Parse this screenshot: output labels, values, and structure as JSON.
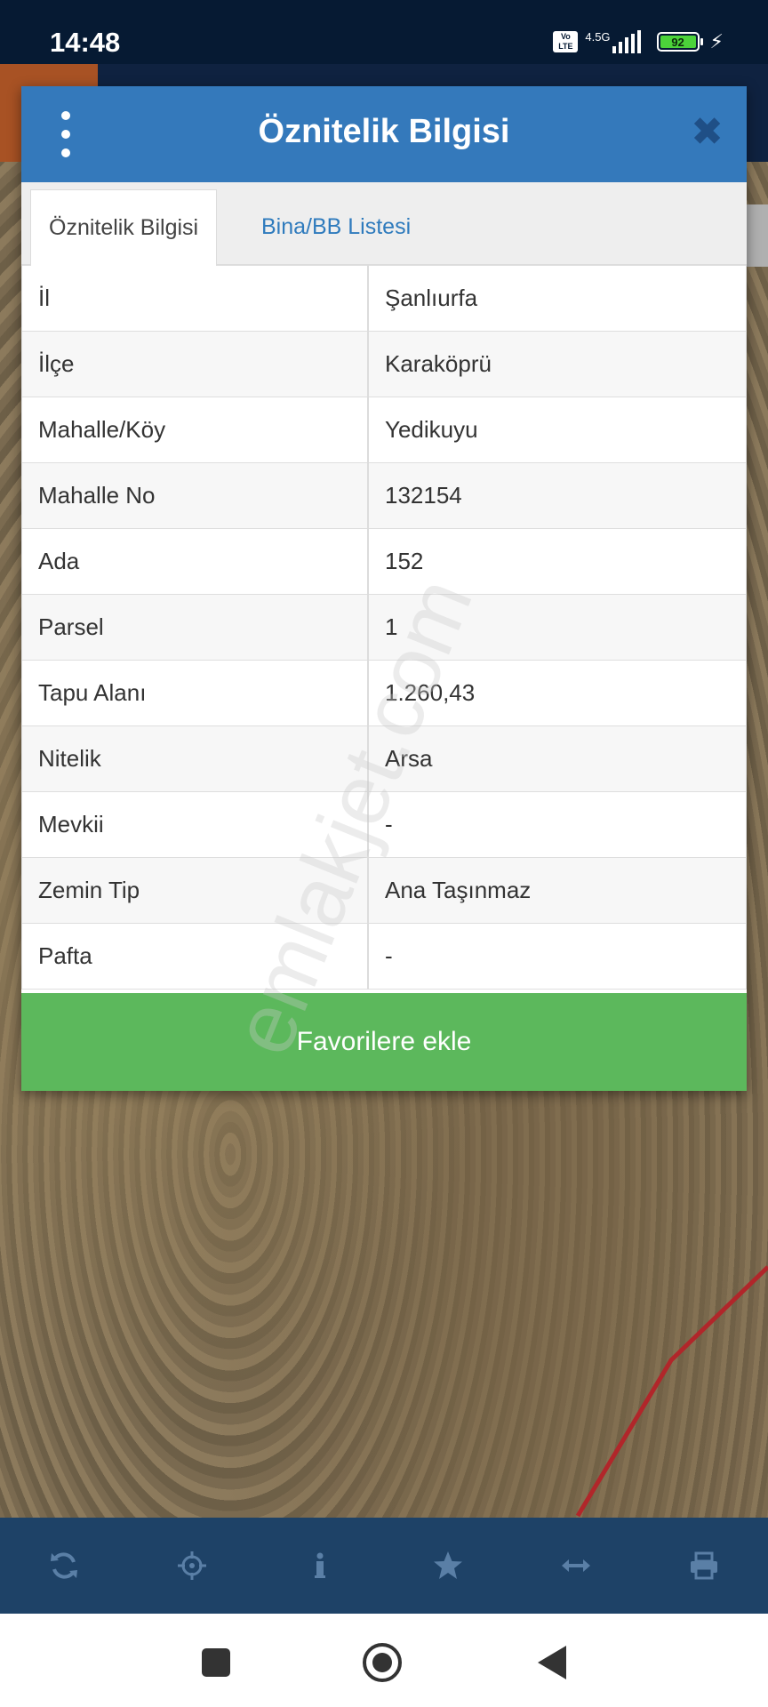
{
  "status_bar": {
    "time": "14:48",
    "volte": "Vo LTE",
    "network": "4.5G",
    "battery": "92"
  },
  "dialog": {
    "title": "Öznitelik Bilgisi",
    "tabs": [
      {
        "label": "Öznitelik Bilgisi",
        "active": true
      },
      {
        "label": "Bina/BB Listesi",
        "active": false
      }
    ],
    "rows": [
      {
        "key": "İl",
        "value": "Şanlıurfa"
      },
      {
        "key": "İlçe",
        "value": "Karaköprü"
      },
      {
        "key": "Mahalle/Köy",
        "value": "Yedikuyu"
      },
      {
        "key": "Mahalle No",
        "value": "132154"
      },
      {
        "key": "Ada",
        "value": "152"
      },
      {
        "key": "Parsel",
        "value": "1"
      },
      {
        "key": "Tapu Alanı",
        "value": "1.260,43"
      },
      {
        "key": "Nitelik",
        "value": "Arsa"
      },
      {
        "key": "Mevkii",
        "value": "-"
      },
      {
        "key": "Zemin Tip",
        "value": "Ana Taşınmaz"
      },
      {
        "key": "Pafta",
        "value": "-"
      }
    ],
    "favorite_button": "Favorilere ekle"
  },
  "watermark": "emlakjet.com",
  "toolbar": {
    "icons": [
      "refresh-icon",
      "locate-icon",
      "info-icon",
      "star-icon",
      "measure-icon",
      "print-icon"
    ]
  },
  "colors": {
    "header": "#3479bb",
    "favorite_button": "#5cb85c",
    "toolbar": "#1e4267",
    "status_bar": "#061a33"
  }
}
